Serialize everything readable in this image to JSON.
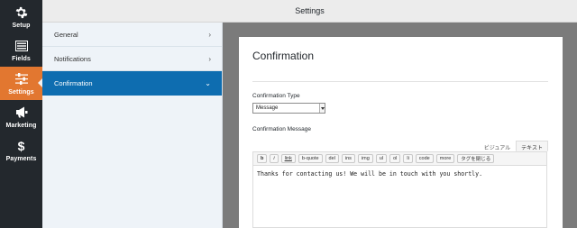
{
  "rail": {
    "items": [
      {
        "label": "Setup",
        "icon": "gear-icon"
      },
      {
        "label": "Fields",
        "icon": "list-icon"
      },
      {
        "label": "Settings",
        "icon": "sliders-icon",
        "active": true
      },
      {
        "label": "Marketing",
        "icon": "megaphone-icon"
      },
      {
        "label": "Payments",
        "icon": "dollar-icon"
      }
    ],
    "active_color": "#e27730",
    "background": "#23282d"
  },
  "header": {
    "title": "Settings"
  },
  "submenu": {
    "items": [
      {
        "label": "General"
      },
      {
        "label": "Notifications"
      },
      {
        "label": "Confirmation",
        "active": true
      }
    ],
    "active_color": "#0e6db0"
  },
  "panel": {
    "title": "Confirmation",
    "type_label": "Confirmation Type",
    "type_value": "Message",
    "message_label": "Confirmation Message",
    "tabs": {
      "visual": "ビジュアル",
      "text": "テキスト"
    },
    "toolbar": [
      "b",
      "i",
      "link",
      "b-quote",
      "del",
      "ins",
      "img",
      "ul",
      "ol",
      "li",
      "code",
      "more",
      "タグを閉じる"
    ],
    "message_text": "Thanks for contacting us! We will be in touch with you shortly."
  }
}
